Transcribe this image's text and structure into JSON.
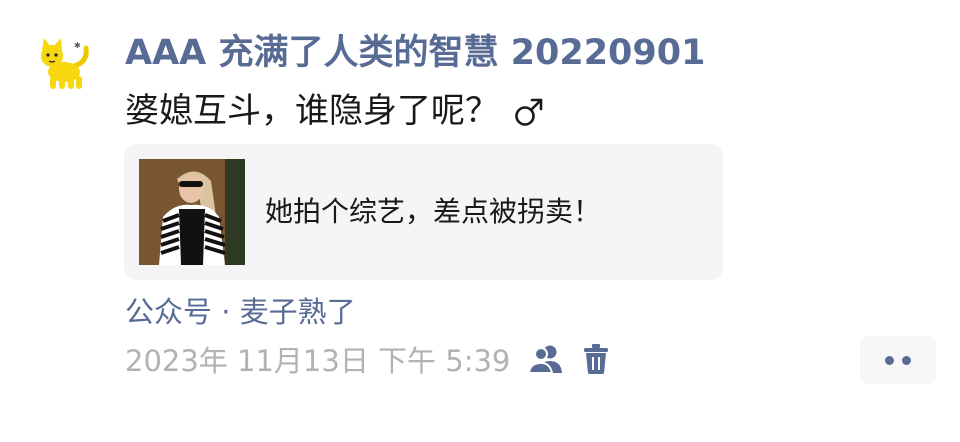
{
  "post": {
    "author_name": "AAA 充满了人类的智慧 20220901",
    "text": "婆媳互斗，谁隐身了呢？",
    "link_card": {
      "title": "她拍个综艺，差点被拐卖！"
    },
    "source": "公众号 · 麦子熟了",
    "timestamp": "2023年 11月13日 下午 5:39"
  },
  "icons": {
    "avatar": "yellow-cat-avatar",
    "gender": "male-sign-icon",
    "visibility": "friends-icon",
    "delete": "trash-icon",
    "more": "more-dots-icon"
  },
  "colors": {
    "author": "#576b95",
    "body_text": "#191919",
    "meta_text": "#b2b2b2",
    "card_bg": "#f5f5f5",
    "avatar_yellow": "#f7d70f"
  }
}
